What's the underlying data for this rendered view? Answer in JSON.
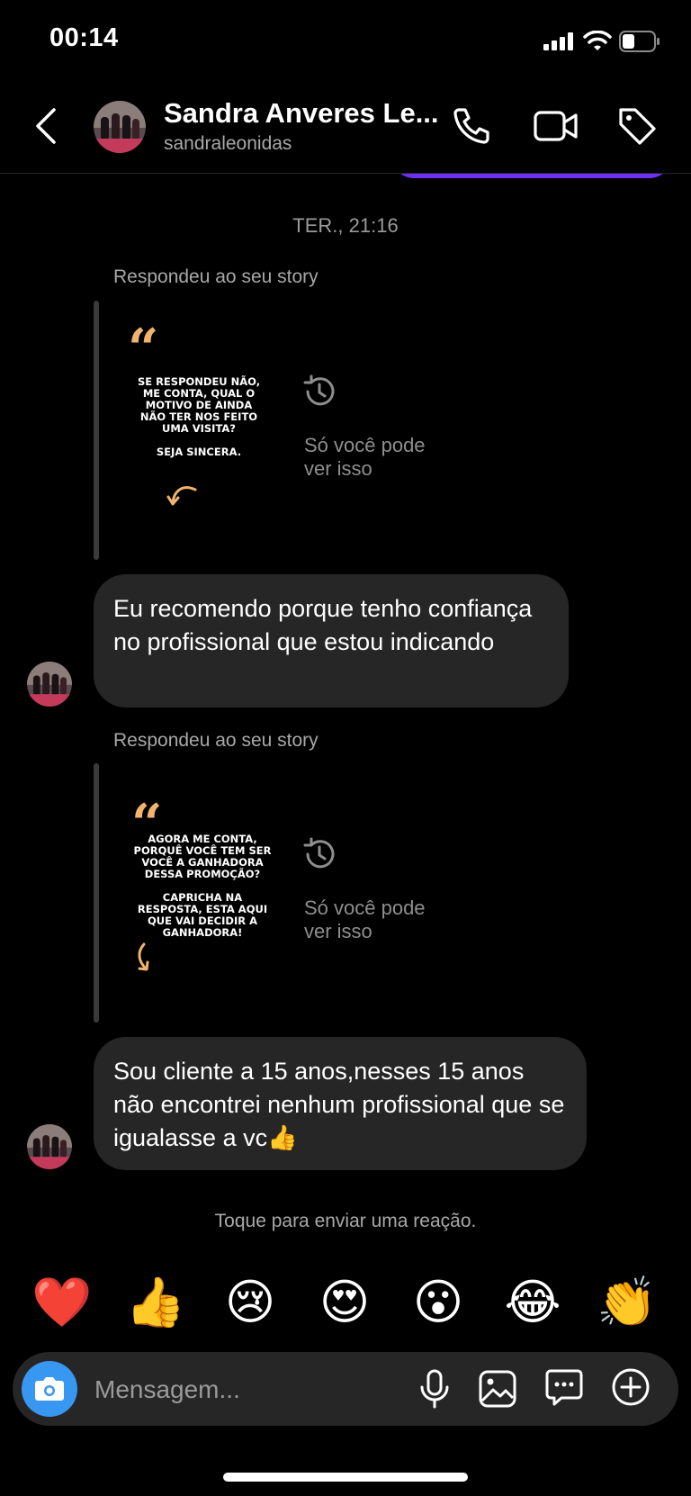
{
  "status_bar": {
    "time": "00:14"
  },
  "header": {
    "contact_name": "Sandra Anveres Le...",
    "username": "sandraleonidas"
  },
  "conversation": {
    "timestamp": "TER., 21:16",
    "messages": [
      {
        "reply_label": "Respondeu ao seu story",
        "story_lines": [
          "SE RESPONDEU NÃO,",
          "ME CONTA, QUAL O",
          "MOTIVO DE AINDA",
          "NÃO TER NOS FEITO",
          "UMA VISITA?",
          "",
          "SEJA SINCERA."
        ],
        "story_private_text": "Só você pode ver isso",
        "text": "Eu recomendo porque tenho confiança no profissional que estou indicando"
      },
      {
        "reply_label": "Respondeu ao seu story",
        "story_lines": [
          "AGORA ME CONTA,",
          "PORQUÊ VOCÊ TEM SER",
          "VOCÊ A GANHADORA",
          "DESSA PROMOÇÃO?",
          "",
          "CAPRICHA NA",
          "RESPOSTA, ESTA AQUI",
          "QUE VAI DECIDIR A",
          "GANHADORA!"
        ],
        "story_private_text": "Só você pode ver isso",
        "text": "Sou cliente a 15 anos,nesses 15 anos não encontrei nenhum profissional que se igualasse a vc👍"
      }
    ]
  },
  "reactions": {
    "hint": "Toque para enviar uma reação.",
    "emojis": [
      "❤️",
      "👍",
      "😢",
      "😍",
      "😮",
      "😂",
      "👏"
    ]
  },
  "composer": {
    "placeholder": "Mensagem..."
  }
}
